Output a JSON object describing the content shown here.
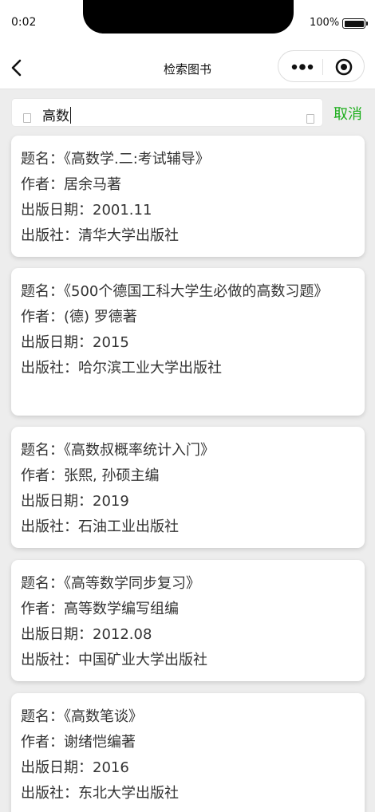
{
  "status": {
    "time": "0:02",
    "battery": "100%"
  },
  "nav": {
    "title": "检索图书"
  },
  "search": {
    "query": "高数",
    "cancel_label": "取消"
  },
  "labels": {
    "title": "题名：",
    "author": "作者：",
    "date": "出版日期：",
    "publisher": "出版社："
  },
  "books": [
    {
      "title": "《高数学.二:考试辅导》",
      "author": "居余马著",
      "date": "2001.11",
      "publisher": "清华大学出版社"
    },
    {
      "title": "《500个德国工科大学生必做的高数习题》",
      "author": "(德) 罗德著",
      "date": "2015",
      "publisher": "哈尔滨工业大学出版社"
    },
    {
      "title": "《高数叔概率统计入门》",
      "author": "张熙, 孙硕主编",
      "date": "2019",
      "publisher": "石油工业出版社"
    },
    {
      "title": "《高等数学同步复习》",
      "author": "高等数学编写组编",
      "date": "2012.08",
      "publisher": "中国矿业大学出版社"
    },
    {
      "title": "《高数笔谈》",
      "author": "谢绪恺编著",
      "date": "2016",
      "publisher": "东北大学出版社"
    }
  ]
}
